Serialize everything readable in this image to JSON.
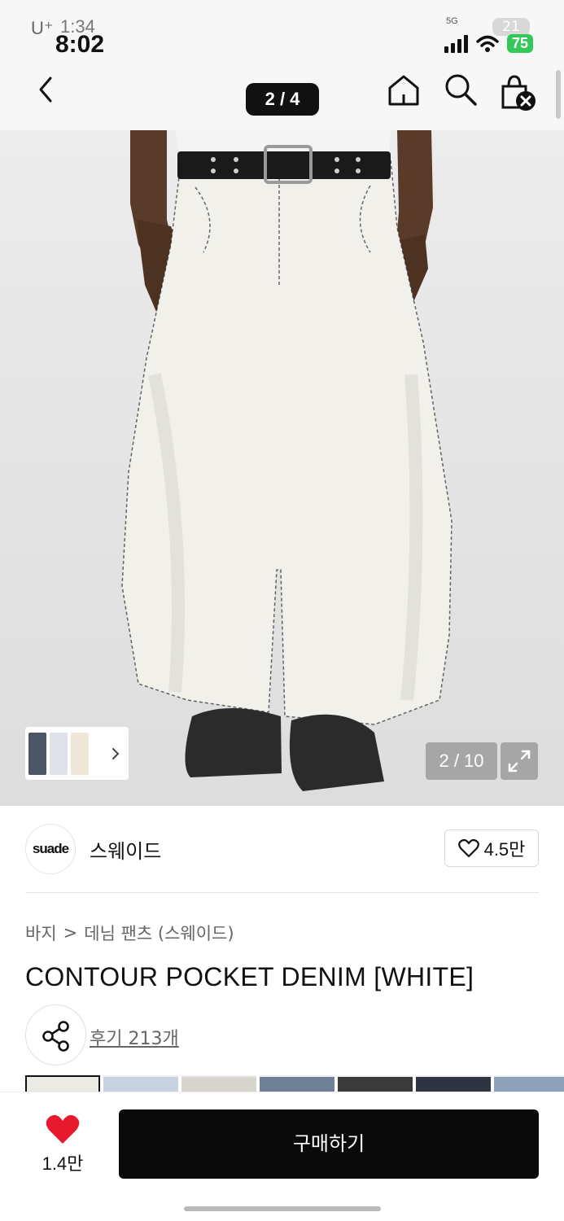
{
  "status_bar": {
    "carrier": "U⁺",
    "time_old": "1:34",
    "time": "8:02",
    "network_badge": "5G",
    "battery_old": "21",
    "battery": "75"
  },
  "nav": {
    "pager": "2 / 4",
    "icons": [
      "back-chevron-icon",
      "home-icon",
      "search-icon",
      "shopping-bag-close-icon"
    ]
  },
  "gallery": {
    "counter": "2 / 10",
    "expand_icon": "expand-arrows-icon",
    "thumbnail_more_icon": "chevron-right-icon"
  },
  "brand": {
    "logo_text": "suade",
    "name": "스웨이드",
    "like_count": "4.5만"
  },
  "product": {
    "breadcrumb": [
      "바지",
      "데님 팬츠 (스웨이드)"
    ],
    "title": "CONTOUR POCKET DENIM [WHITE]",
    "review_link": "후기 213개"
  },
  "bottom_bar": {
    "heart_count": "1.4만",
    "buy_label": "구매하기",
    "heart_color": "#e8192c"
  }
}
